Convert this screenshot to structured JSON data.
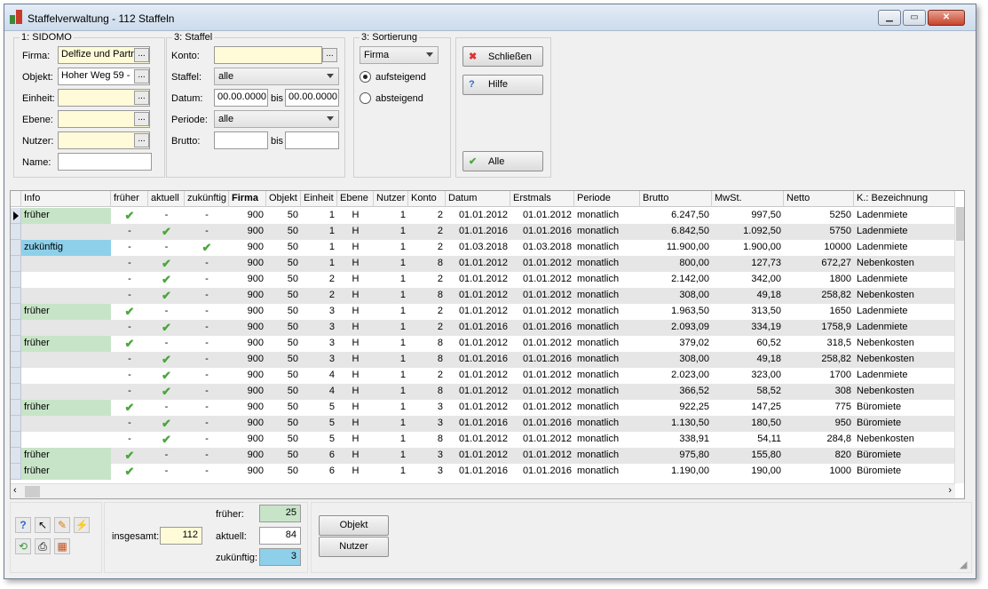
{
  "window": {
    "title": "Staffelverwaltung - 112 Staffeln"
  },
  "sidomo": {
    "title": "1: SIDOMO",
    "firma_label": "Firma:",
    "firma_value": "Delfize und Partr",
    "objekt_label": "Objekt:",
    "objekt_value": "Hoher Weg 59 -",
    "einheit_label": "Einheit:",
    "ebene_label": "Ebene:",
    "nutzer_label": "Nutzer:",
    "name_label": "Name:"
  },
  "staffel": {
    "title": "3: Staffel",
    "konto_label": "Konto:",
    "staffel_label": "Staffel:",
    "staffel_value": "alle",
    "datum_label": "Datum:",
    "datum_from": "00.00.0000",
    "bis_label": "bis",
    "datum_to": "00.00.0000",
    "periode_label": "Periode:",
    "periode_value": "alle",
    "brutto_label": "Brutto:"
  },
  "sortierung": {
    "title": "3: Sortierung",
    "field_value": "Firma",
    "asc_label": "aufsteigend",
    "desc_label": "absteigend"
  },
  "buttons": {
    "close": "Schließen",
    "help": "Hilfe",
    "all": "Alle",
    "objekt": "Objekt",
    "nutzer": "Nutzer"
  },
  "table": {
    "columns": [
      "Info",
      "früher",
      "aktuell",
      "zukünftig",
      "Firma",
      "Objekt",
      "Einheit",
      "Ebene",
      "Nutzer",
      "Konto",
      "Datum",
      "Erstmals",
      "Periode",
      "Brutto",
      "MwSt.",
      "Netto",
      "K.: Bezeichnung"
    ],
    "rows": [
      {
        "info": "früher",
        "f": "✔",
        "a": "-",
        "z": "-",
        "firma": "900",
        "objekt": "50",
        "einheit": "1",
        "ebene": "H",
        "nutzer": "1",
        "konto": "2",
        "datum": "01.01.2012",
        "erstmals": "01.01.2012",
        "periode": "monatlich",
        "brutto": "6.247,50",
        "mwst": "997,50",
        "netto": "5250",
        "bez": "Ladenmiete"
      },
      {
        "info": "",
        "f": "-",
        "a": "✔",
        "z": "-",
        "firma": "900",
        "objekt": "50",
        "einheit": "1",
        "ebene": "H",
        "nutzer": "1",
        "konto": "2",
        "datum": "01.01.2016",
        "erstmals": "01.01.2016",
        "periode": "monatlich",
        "brutto": "6.842,50",
        "mwst": "1.092,50",
        "netto": "5750",
        "bez": "Ladenmiete"
      },
      {
        "info": "zukünftig",
        "f": "-",
        "a": "-",
        "z": "✔",
        "firma": "900",
        "objekt": "50",
        "einheit": "1",
        "ebene": "H",
        "nutzer": "1",
        "konto": "2",
        "datum": "01.03.2018",
        "erstmals": "01.03.2018",
        "periode": "monatlich",
        "brutto": "11.900,00",
        "mwst": "1.900,00",
        "netto": "10000",
        "bez": "Ladenmiete"
      },
      {
        "info": "",
        "f": "-",
        "a": "✔",
        "z": "-",
        "firma": "900",
        "objekt": "50",
        "einheit": "1",
        "ebene": "H",
        "nutzer": "1",
        "konto": "8",
        "datum": "01.01.2012",
        "erstmals": "01.01.2012",
        "periode": "monatlich",
        "brutto": "800,00",
        "mwst": "127,73",
        "netto": "672,27",
        "bez": "Nebenkosten"
      },
      {
        "info": "",
        "f": "-",
        "a": "✔",
        "z": "-",
        "firma": "900",
        "objekt": "50",
        "einheit": "2",
        "ebene": "H",
        "nutzer": "1",
        "konto": "2",
        "datum": "01.01.2012",
        "erstmals": "01.01.2012",
        "periode": "monatlich",
        "brutto": "2.142,00",
        "mwst": "342,00",
        "netto": "1800",
        "bez": "Ladenmiete"
      },
      {
        "info": "",
        "f": "-",
        "a": "✔",
        "z": "-",
        "firma": "900",
        "objekt": "50",
        "einheit": "2",
        "ebene": "H",
        "nutzer": "1",
        "konto": "8",
        "datum": "01.01.2012",
        "erstmals": "01.01.2012",
        "periode": "monatlich",
        "brutto": "308,00",
        "mwst": "49,18",
        "netto": "258,82",
        "bez": "Nebenkosten"
      },
      {
        "info": "früher",
        "f": "✔",
        "a": "-",
        "z": "-",
        "firma": "900",
        "objekt": "50",
        "einheit": "3",
        "ebene": "H",
        "nutzer": "1",
        "konto": "2",
        "datum": "01.01.2012",
        "erstmals": "01.01.2012",
        "periode": "monatlich",
        "brutto": "1.963,50",
        "mwst": "313,50",
        "netto": "1650",
        "bez": "Ladenmiete"
      },
      {
        "info": "",
        "f": "-",
        "a": "✔",
        "z": "-",
        "firma": "900",
        "objekt": "50",
        "einheit": "3",
        "ebene": "H",
        "nutzer": "1",
        "konto": "2",
        "datum": "01.01.2016",
        "erstmals": "01.01.2016",
        "periode": "monatlich",
        "brutto": "2.093,09",
        "mwst": "334,19",
        "netto": "1758,9",
        "bez": "Ladenmiete"
      },
      {
        "info": "früher",
        "f": "✔",
        "a": "-",
        "z": "-",
        "firma": "900",
        "objekt": "50",
        "einheit": "3",
        "ebene": "H",
        "nutzer": "1",
        "konto": "8",
        "datum": "01.01.2012",
        "erstmals": "01.01.2012",
        "periode": "monatlich",
        "brutto": "379,02",
        "mwst": "60,52",
        "netto": "318,5",
        "bez": "Nebenkosten"
      },
      {
        "info": "",
        "f": "-",
        "a": "✔",
        "z": "-",
        "firma": "900",
        "objekt": "50",
        "einheit": "3",
        "ebene": "H",
        "nutzer": "1",
        "konto": "8",
        "datum": "01.01.2016",
        "erstmals": "01.01.2016",
        "periode": "monatlich",
        "brutto": "308,00",
        "mwst": "49,18",
        "netto": "258,82",
        "bez": "Nebenkosten"
      },
      {
        "info": "",
        "f": "-",
        "a": "✔",
        "z": "-",
        "firma": "900",
        "objekt": "50",
        "einheit": "4",
        "ebene": "H",
        "nutzer": "1",
        "konto": "2",
        "datum": "01.01.2012",
        "erstmals": "01.01.2012",
        "periode": "monatlich",
        "brutto": "2.023,00",
        "mwst": "323,00",
        "netto": "1700",
        "bez": "Ladenmiete"
      },
      {
        "info": "",
        "f": "-",
        "a": "✔",
        "z": "-",
        "firma": "900",
        "objekt": "50",
        "einheit": "4",
        "ebene": "H",
        "nutzer": "1",
        "konto": "8",
        "datum": "01.01.2012",
        "erstmals": "01.01.2012",
        "periode": "monatlich",
        "brutto": "366,52",
        "mwst": "58,52",
        "netto": "308",
        "bez": "Nebenkosten"
      },
      {
        "info": "früher",
        "f": "✔",
        "a": "-",
        "z": "-",
        "firma": "900",
        "objekt": "50",
        "einheit": "5",
        "ebene": "H",
        "nutzer": "1",
        "konto": "3",
        "datum": "01.01.2012",
        "erstmals": "01.01.2012",
        "periode": "monatlich",
        "brutto": "922,25",
        "mwst": "147,25",
        "netto": "775",
        "bez": "Büromiete"
      },
      {
        "info": "",
        "f": "-",
        "a": "✔",
        "z": "-",
        "firma": "900",
        "objekt": "50",
        "einheit": "5",
        "ebene": "H",
        "nutzer": "1",
        "konto": "3",
        "datum": "01.01.2016",
        "erstmals": "01.01.2016",
        "periode": "monatlich",
        "brutto": "1.130,50",
        "mwst": "180,50",
        "netto": "950",
        "bez": "Büromiete"
      },
      {
        "info": "",
        "f": "-",
        "a": "✔",
        "z": "-",
        "firma": "900",
        "objekt": "50",
        "einheit": "5",
        "ebene": "H",
        "nutzer": "1",
        "konto": "8",
        "datum": "01.01.2012",
        "erstmals": "01.01.2012",
        "periode": "monatlich",
        "brutto": "338,91",
        "mwst": "54,11",
        "netto": "284,8",
        "bez": "Nebenkosten"
      },
      {
        "info": "früher",
        "f": "✔",
        "a": "-",
        "z": "-",
        "firma": "900",
        "objekt": "50",
        "einheit": "6",
        "ebene": "H",
        "nutzer": "1",
        "konto": "3",
        "datum": "01.01.2012",
        "erstmals": "01.01.2012",
        "periode": "monatlich",
        "brutto": "975,80",
        "mwst": "155,80",
        "netto": "820",
        "bez": "Büromiete"
      },
      {
        "info": "früher",
        "f": "✔",
        "a": "-",
        "z": "-",
        "firma": "900",
        "objekt": "50",
        "einheit": "6",
        "ebene": "H",
        "nutzer": "1",
        "konto": "3",
        "datum": "01.01.2016",
        "erstmals": "01.01.2016",
        "periode": "monatlich",
        "brutto": "1.190,00",
        "mwst": "190,00",
        "netto": "1000",
        "bez": "Büromiete"
      }
    ]
  },
  "summary": {
    "insgesamt_label": "insgesamt:",
    "insgesamt_value": "112",
    "frueher_label": "früher:",
    "frueher_value": "25",
    "aktuell_label": "aktuell:",
    "aktuell_value": "84",
    "zukuenftig_label": "zukünftig:",
    "zukuenftig_value": "3"
  },
  "colors": {
    "frueher": "#c8e4c8",
    "zukuenftig": "#8ed0ea",
    "check": "#4aa83a",
    "yellow_field": "#fffbd8"
  }
}
